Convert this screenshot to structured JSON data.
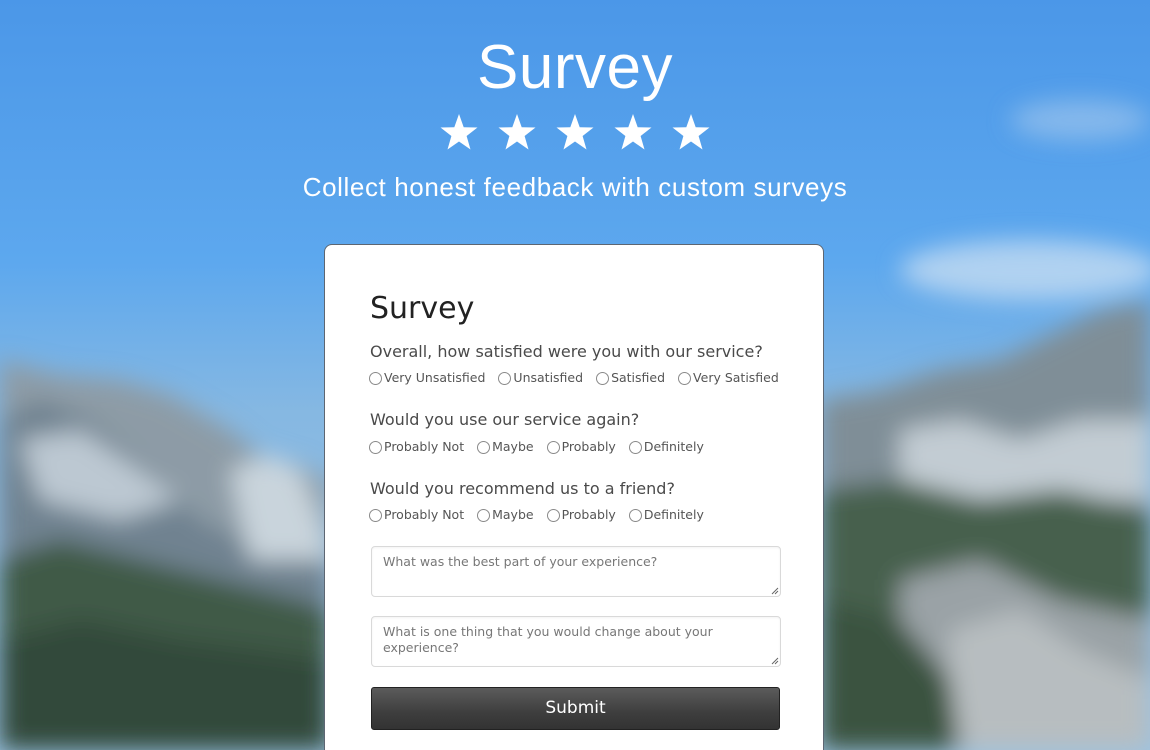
{
  "hero": {
    "title": "Survey",
    "star_count": 5,
    "subtitle": "Collect honest feedback with custom surveys"
  },
  "form": {
    "title": "Survey",
    "questions": [
      {
        "label": "Overall, how satisfied were you with our service?",
        "options": [
          "Very Unsatisfied",
          "Unsatisfied",
          "Satisfied",
          "Very Satisfied"
        ]
      },
      {
        "label": "Would you use our service again?",
        "options": [
          "Probably Not",
          "Maybe",
          "Probably",
          "Definitely"
        ]
      },
      {
        "label": "Would you recommend us to a friend?",
        "options": [
          "Probably Not",
          "Maybe",
          "Probably",
          "Definitely"
        ]
      }
    ],
    "textareas": [
      {
        "value": "",
        "placeholder": "What was the best part of your experience?"
      },
      {
        "value": "",
        "placeholder": "What is one thing that you would change about your experience?"
      }
    ],
    "submit_label": "Submit"
  },
  "colors": {
    "sky": "#5aa6ee",
    "button": "#3e3e3e",
    "text": "#4a4a4a"
  }
}
